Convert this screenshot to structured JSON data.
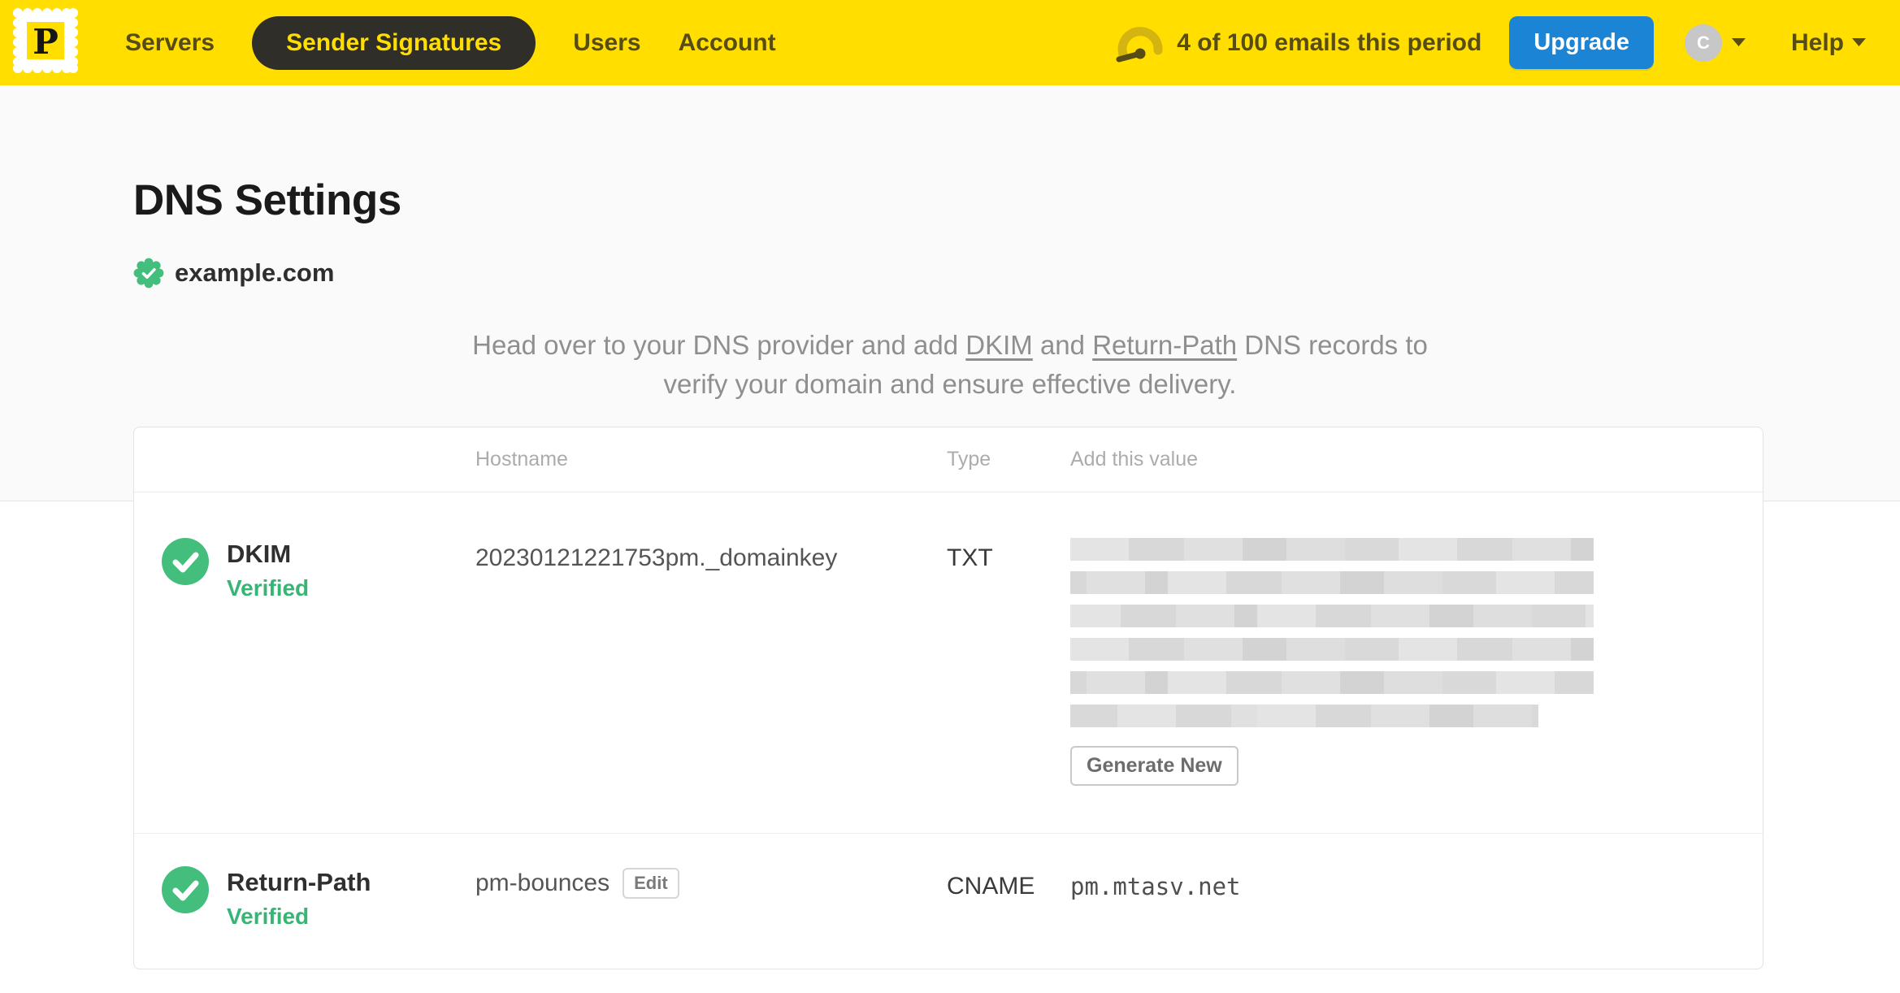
{
  "nav": {
    "logo_letter": "P",
    "items": [
      {
        "id": "servers",
        "label": "Servers",
        "active": false
      },
      {
        "id": "sender-signatures",
        "label": "Sender Signatures",
        "active": true
      },
      {
        "id": "users",
        "label": "Users",
        "active": false
      },
      {
        "id": "account",
        "label": "Account",
        "active": false
      }
    ],
    "usage_text": "4 of 100 emails this period",
    "upgrade_label": "Upgrade",
    "avatar_initial": "C",
    "help_label": "Help"
  },
  "page": {
    "title": "DNS Settings",
    "domain": "example.com",
    "description": {
      "part1": "Head over to your DNS provider and add ",
      "link_dkim": "DKIM",
      "part2": " and ",
      "link_return_path": "Return-Path",
      "part3": " DNS records to verify your domain and ensure effective delivery."
    }
  },
  "table": {
    "headers": {
      "hostname": "Hostname",
      "type": "Type",
      "value": "Add this value"
    },
    "dkim_row": {
      "name": "DKIM",
      "status": "Verified",
      "hostname": "20230121221753pm._domainkey",
      "type": "TXT",
      "value_redacted": true,
      "redacted_line_widths": [
        644,
        644,
        644,
        644,
        644,
        576
      ],
      "action_label": "Generate New"
    },
    "return_path_row": {
      "name": "Return-Path",
      "status": "Verified",
      "hostname": "pm-bounces",
      "edit_label": "Edit",
      "type": "CNAME",
      "value": "pm.mtasv.net"
    }
  },
  "colors": {
    "brand_yellow": "#FFDE00",
    "nav_text": "#564C14",
    "active_pill_bg": "#302E28",
    "upgrade_blue": "#1B84D4",
    "verified_green": "#44BE7D",
    "verified_text": "#38B475",
    "page_bg_top": "#FAFAFA"
  }
}
